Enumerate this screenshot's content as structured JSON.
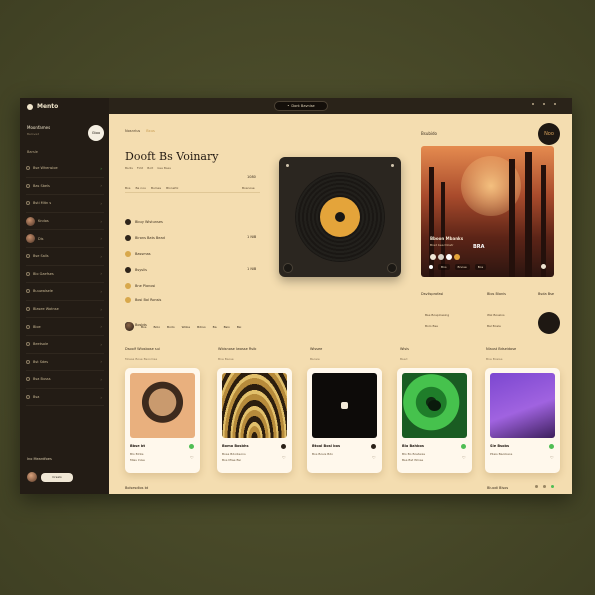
{
  "app": {
    "title": "Mento",
    "search_label": "Dont Bavnise"
  },
  "colors": {
    "accent": "#e4a43a",
    "green": "#4fbe54",
    "dark": "#231c15",
    "panel": "#f4ddb0"
  },
  "sidebar": {
    "heading": "Moonfames",
    "subheading": "Beloved",
    "circle_button": "Gtoo",
    "section": "Barsle",
    "items": [
      {
        "label": "Bse Whensloe",
        "avatar": false,
        "chev": "green"
      },
      {
        "label": "Bas Sbels",
        "avatar": false,
        "chev": "plain"
      },
      {
        "label": "Bsti Mitn s",
        "avatar": false,
        "chev": "plain"
      },
      {
        "label": "Kndos",
        "avatar": true,
        "chev": "plain"
      },
      {
        "label": "Dis",
        "avatar": true,
        "chev": "plain"
      },
      {
        "label": "Bse Salls",
        "avatar": false,
        "chev": "plain"
      },
      {
        "label": "Blo Gaefses",
        "avatar": false,
        "chev": "plain"
      },
      {
        "label": "Buuwalsele",
        "avatar": false,
        "chev": "plain"
      },
      {
        "label": "Blasee Wotnse",
        "avatar": false,
        "chev": "plain"
      },
      {
        "label": "Bloe",
        "avatar": false,
        "chev": "plain"
      },
      {
        "label": "Beetsole",
        "avatar": false,
        "chev": "plain"
      },
      {
        "label": "Bst Sdes",
        "avatar": false,
        "chev": "plain"
      },
      {
        "label": "Bsa Busss",
        "avatar": false,
        "chev": "plain"
      },
      {
        "label": "Bsa",
        "avatar": false,
        "chev": "plain"
      }
    ],
    "footer": "Ino Meardfoes",
    "user_pill": "Crsalo"
  },
  "main": {
    "breadcrumb": [
      "Nosnrlus",
      "Bxus"
    ],
    "title": "Dooft Bs Voinary",
    "meta": [
      "Bsdis",
      "Fldd",
      "Bolt",
      "Gse Bses"
    ],
    "meta_value": "1080",
    "labels": [
      "Bos",
      "Ba nou",
      "Bulnes",
      "Blonefol"
    ],
    "labels_value": "Bosnose",
    "tracks": [
      {
        "title": "Bbuy Wistunses",
        "value": "",
        "gold": false
      },
      {
        "title": "Birons Bats Bead",
        "value": "1 NlB",
        "gold": false
      },
      {
        "title": "Bassmas",
        "value": "",
        "gold": true
      },
      {
        "title": "Bsyslis",
        "value": "1 NlB",
        "gold": false
      },
      {
        "title": "Bne Plonosi",
        "value": "",
        "gold": true
      },
      {
        "title": "Bosi Bol Ronsis",
        "value": "",
        "gold": true
      },
      {
        "title": "Bosbts",
        "value": "",
        "gold": false
      }
    ],
    "pills": [
      "Bos",
      "Bolo",
      "Bodo",
      "Wobe",
      "Bdrso",
      "Ba",
      "Bsio",
      "Bsi"
    ]
  },
  "now_playing": {
    "label": "Bsubido",
    "button": "Noo",
    "cover_title": "Bboon Mbanks",
    "cover_sub": "Brad bea Dlostr",
    "cover_bpm": "BRA",
    "cover_tags": [
      "Bns",
      "Bnose",
      "Bos"
    ],
    "swatches": [
      "#f0e6d6",
      "#d9d2c7",
      "#ffffff",
      "#e4a43a"
    ],
    "stats_head": [
      "Dsvilsprofasl",
      "Blos Blonis",
      "Bsda Bse"
    ],
    "stats_rows": [
      [
        "Bse Bosplossing",
        "Wsl Bosslos"
      ],
      [
        "Bolo Bse",
        "Bal Bosle"
      ]
    ]
  },
  "categories": {
    "heads": [
      "Dsoolf Wiosbose sui",
      "Wbisnose Iwosse Rsib",
      "Wissee",
      "Wisis",
      "Nlaust Bdseidose"
    ],
    "subs": [
      "Mossa Bose Bsoomse",
      "Bne Bsose",
      "Bsosie",
      "Bsed",
      "Bne Bosise"
    ]
  },
  "cards": [
    {
      "name": "Bbse bt",
      "sub": "Blo Blnte",
      "sub2": "Mlas Inlse",
      "art": "orange",
      "mark": "#4fbe54"
    },
    {
      "name": "Bomo Bosbhs",
      "sub": "Bosa Bdoibsons",
      "sub2": "Bos Mlae Bsi",
      "art": "gold",
      "mark": "#2a2118"
    },
    {
      "name": "Btoal Bosi bos",
      "sub": "Bos Bosis Bdo",
      "sub2": "",
      "art": "black",
      "mark": "#2a2118"
    },
    {
      "name": "Bla Bahbos",
      "sub": "Blo Bo Bostwas",
      "sub2": "Bsa Bst Wlnse",
      "art": "green",
      "mark": "#4fbe54"
    },
    {
      "name": "Sle Bsobs",
      "sub": "Pbsis Baoibaos",
      "sub2": "",
      "art": "purple",
      "mark": "#4fbe54"
    }
  ],
  "footer": {
    "left": "Bolsesdlos bt",
    "right": "Bluodi Blsos"
  }
}
